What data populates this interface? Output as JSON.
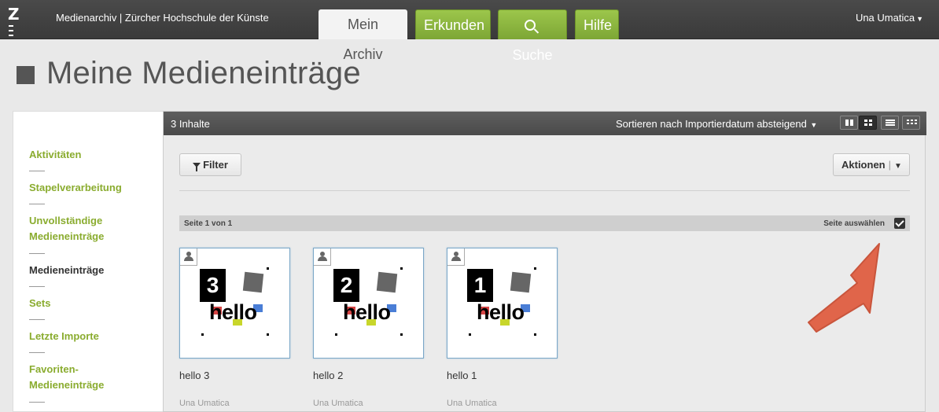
{
  "app": {
    "logo_letter": "Z",
    "title": "Medienarchiv | Zürcher Hochschule der Künste"
  },
  "nav": {
    "tabs": [
      {
        "label": "Mein Archiv",
        "active": true
      },
      {
        "label": "Erkunden"
      },
      {
        "label": "Suche",
        "icon": "search-icon"
      },
      {
        "label": "Hilfe"
      }
    ],
    "user": "Una Umatica"
  },
  "page": {
    "title": "Meine Medieneinträge"
  },
  "sidebar": {
    "items": [
      {
        "label": "Aktivitäten"
      },
      {
        "label": "Stapelverarbeitung"
      },
      {
        "label": "Unvollständige",
        "label2": "Medieneinträge"
      },
      {
        "label": "Medieneinträge",
        "current": true
      },
      {
        "label": "Sets"
      },
      {
        "label": "Letzte Importe"
      },
      {
        "label": "Favoriten-",
        "label2": "Medieneinträge"
      }
    ]
  },
  "main": {
    "count": "3 Inhalte",
    "sort_label": "Sortieren nach Importierdatum absteigend",
    "view_modes": [
      "tiles-large",
      "grid",
      "list",
      "miniature"
    ],
    "active_view": "grid",
    "filter_label": "Filter",
    "actions_label": "Aktionen",
    "pager": "Seite 1 von 1",
    "select_page": "Seite auswählen",
    "select_page_checked": true
  },
  "media": [
    {
      "title": "hello 3",
      "owner": "Una Umatica",
      "number": "3",
      "text": "hello"
    },
    {
      "title": "hello 2",
      "owner": "Una Umatica",
      "number": "2",
      "text": "hello"
    },
    {
      "title": "hello 1",
      "owner": "Una Umatica",
      "number": "1",
      "text": "hello"
    }
  ],
  "colors": {
    "accent_green": "#8aac2f",
    "annotation_arrow": "#e0654a"
  }
}
